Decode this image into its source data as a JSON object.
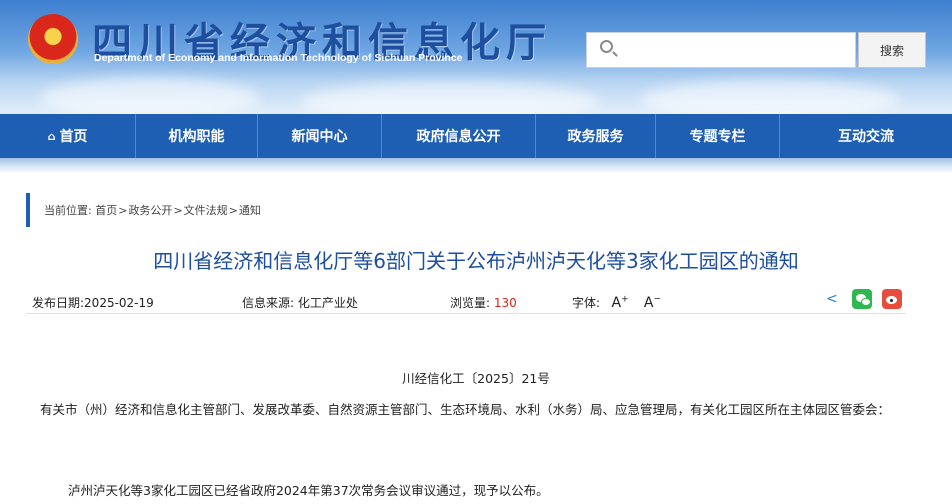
{
  "header": {
    "site_title": "四川省经济和信息化厅",
    "site_subtitle": "Department of Economy and Information Technology of Sichuan Province",
    "search_placeholder": "",
    "search_button": "搜索"
  },
  "nav": {
    "items": [
      {
        "label": "首页",
        "icon": "home-icon"
      },
      {
        "label": "机构职能"
      },
      {
        "label": "新闻中心"
      },
      {
        "label": "政府信息公开"
      },
      {
        "label": "政务服务"
      },
      {
        "label": "专题专栏"
      },
      {
        "label": "互动交流"
      }
    ]
  },
  "breadcrumb": {
    "prefix": "当前位置:",
    "items": [
      "首页",
      "政务公开",
      "文件法规",
      "通知"
    ],
    "separator": ">"
  },
  "article": {
    "title": "四川省经济和信息化厅等6部门关于公布泸州泸天化等3家化工园区的通知",
    "publish_label": "发布日期:",
    "publish_date": "2025-02-19",
    "source_label": "信息来源:",
    "source": "化工产业处",
    "views_label": "浏览量:",
    "views": "130",
    "font_label": "字体:",
    "font_larger": "A",
    "font_larger_sign": "+",
    "font_smaller": "A",
    "font_smaller_sign": "−",
    "doc_number": "川经信化工〔2025〕21号",
    "addressee": "有关市（州）经济和信息化主管部门、发展改革委、自然资源主管部门、生态环境局、水利（水务）局、应急管理局，有关化工园区所在主体园区管委会：",
    "paragraph1": "泸州泸天化等3家化工园区已经省政府2024年第37次常务会议审议通过，现予以公布。"
  },
  "share": {
    "icons": [
      "share-icon",
      "wechat-icon",
      "weibo-icon"
    ]
  },
  "colors": {
    "nav_bg": "#1e5fb4",
    "title_color": "#1d4f9e",
    "views_color": "#d0281d"
  }
}
